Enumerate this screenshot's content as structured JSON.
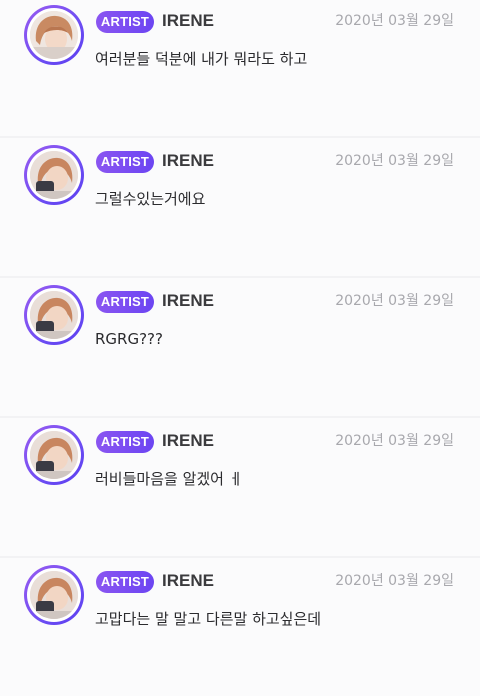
{
  "feed": {
    "posts": [
      {
        "badge": "ARTIST",
        "author": "IRENE",
        "date": "2020년 03월 29일",
        "message": "여러분들 덕분에 내가 뭐라도 하고"
      },
      {
        "badge": "ARTIST",
        "author": "IRENE",
        "date": "2020년 03월 29일",
        "message": "그럴수있는거에요"
      },
      {
        "badge": "ARTIST",
        "author": "IRENE",
        "date": "2020년 03월 29일",
        "message": "RGRG???"
      },
      {
        "badge": "ARTIST",
        "author": "IRENE",
        "date": "2020년 03월 29일",
        "message": "러비들마음을 알겠어 ㅔ"
      },
      {
        "badge": "ARTIST",
        "author": "IRENE",
        "date": "2020년 03월 29일",
        "message": "고맙다는 말 말고 다른말 하고싶은데"
      }
    ]
  },
  "colors": {
    "badge_gradient_start": "#8a55f1",
    "badge_gradient_end": "#6c45f2",
    "avatar_ring": "#7a50f2",
    "background": "#f2f2f4",
    "card": "#fbfbfc"
  }
}
